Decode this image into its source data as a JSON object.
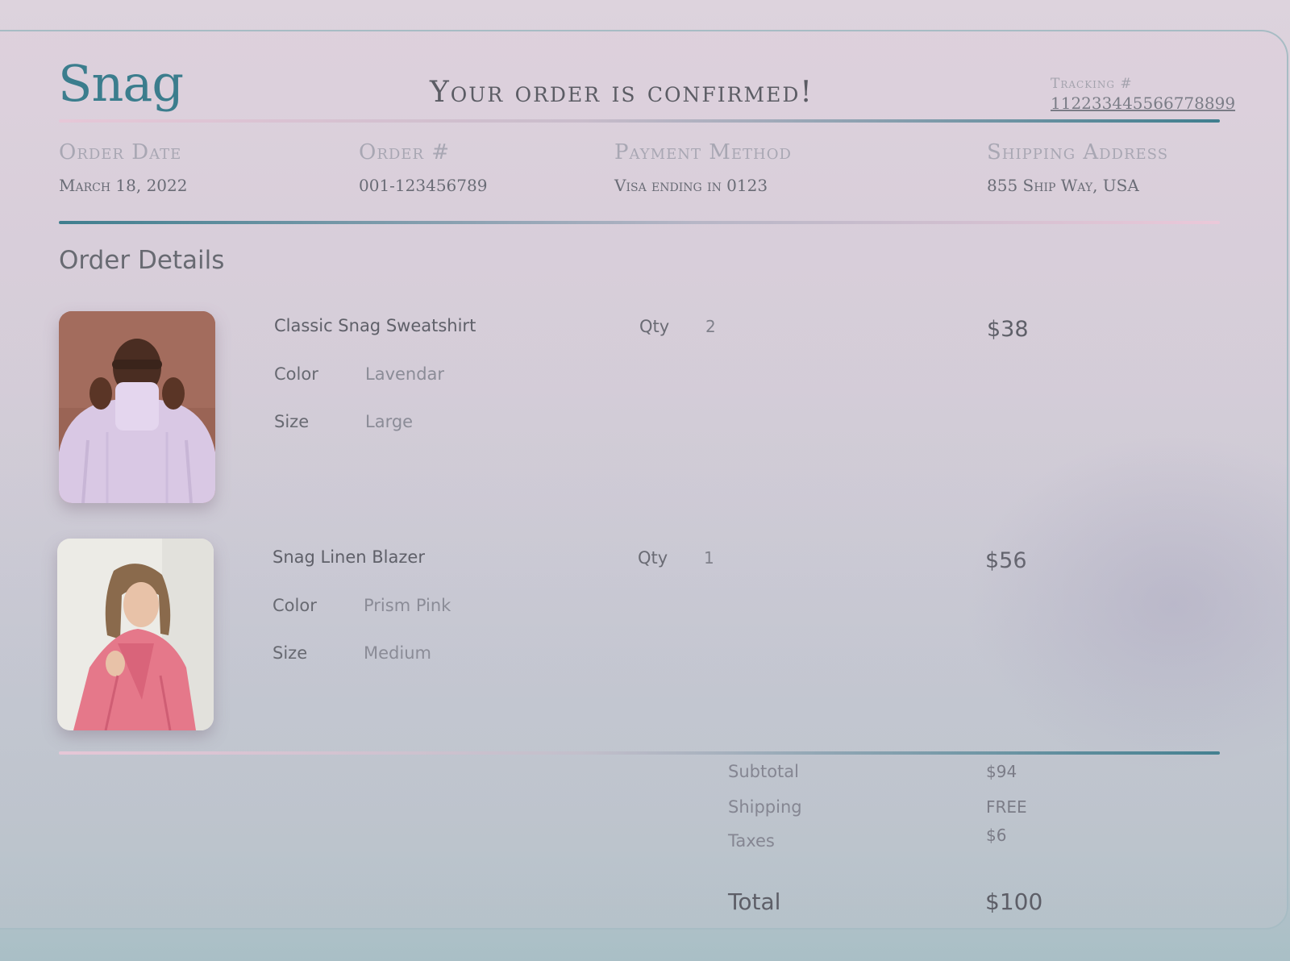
{
  "brand": {
    "logo": "Snag"
  },
  "header": {
    "headline": "Your order is confirmed!",
    "tracking_label": "Tracking #",
    "tracking_number": "112233445566778899"
  },
  "order_info": {
    "order_date_label": "Order Date",
    "order_date": "March 18, 2022",
    "order_number_label": "Order #",
    "order_number": "001-123456789",
    "payment_label": "Payment Method",
    "payment": "Visa ending in 0123",
    "shipping_label": "Shipping Address",
    "shipping": "855 Ship Way, USA"
  },
  "details": {
    "title": "Order Details",
    "color_label": "Color",
    "size_label": "Size",
    "qty_label": "Qty"
  },
  "items": [
    {
      "name": "Classic Snag Sweatshirt",
      "color": "Lavendar",
      "size": "Large",
      "qty": "2",
      "price": "$38"
    },
    {
      "name": "Snag Linen Blazer",
      "color": "Prism Pink",
      "size": "Medium",
      "qty": "1",
      "price": "$56"
    }
  ],
  "summary": {
    "subtotal_label": "Subtotal",
    "subtotal": "$94",
    "shipping_label": "Shipping",
    "shipping": "FREE",
    "taxes_label": "Taxes",
    "taxes": "$6",
    "total_label": "Total",
    "total": "$100"
  },
  "colors": {
    "brand_teal": "#3b7d8d",
    "accent_pink": "#e6c7d7"
  }
}
